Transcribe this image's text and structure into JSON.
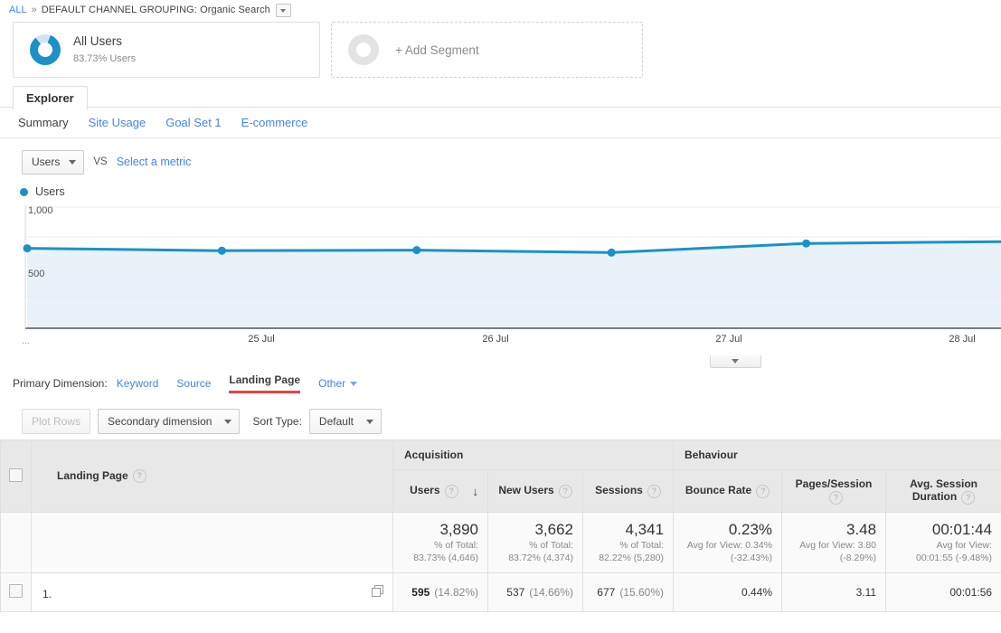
{
  "breadcrumb": {
    "all": "ALL",
    "separator": "»",
    "label": "DEFAULT CHANNEL GROUPING: Organic Search"
  },
  "segments": {
    "all_users": {
      "title": "All Users",
      "subtitle": "83.73% Users",
      "percent": 83.73
    },
    "add_segment": {
      "label": "+ Add Segment"
    }
  },
  "explorer": {
    "tab_label": "Explorer",
    "subtabs": [
      {
        "label": "Summary",
        "active": true
      },
      {
        "label": "Site Usage",
        "active": false
      },
      {
        "label": "Goal Set 1",
        "active": false
      },
      {
        "label": "E-commerce",
        "active": false
      }
    ]
  },
  "metric_selector": {
    "selected": "Users",
    "vs": "VS",
    "select_metric": "Select a metric"
  },
  "legend": {
    "label": "Users",
    "color": "#1c91c7"
  },
  "chart_data": {
    "type": "line",
    "title": "Users",
    "xlabel": "",
    "ylabel": "Users",
    "categories": [
      "",
      "25 Jul",
      "26 Jul",
      "27 Jul",
      "28 Jul",
      ""
    ],
    "x_tick_labels": [
      "25 Jul",
      "26 Jul",
      "27 Jul",
      "28 Jul"
    ],
    "y_tick_labels": [
      "1,000",
      "500"
    ],
    "ylim": [
      0,
      1000
    ],
    "grid": true,
    "legend_position": "top-left",
    "series": [
      {
        "name": "Users",
        "color": "#1c91c7",
        "fill": "#e8f2f8",
        "values": [
          660,
          640,
          645,
          625,
          700,
          715
        ]
      }
    ],
    "x_ellipsis": "..."
  },
  "primary_dimension": {
    "label": "Primary Dimension:",
    "items": [
      {
        "label": "Keyword",
        "active": false,
        "caret": false
      },
      {
        "label": "Source",
        "active": false,
        "caret": false
      },
      {
        "label": "Landing Page",
        "active": true,
        "caret": false
      },
      {
        "label": "Other",
        "active": false,
        "caret": true
      }
    ]
  },
  "toolbar": {
    "plot_rows": "Plot Rows",
    "secondary_dimension": "Secondary dimension",
    "sort_type_label": "Sort Type:",
    "sort_type_value": "Default"
  },
  "table": {
    "groups": [
      {
        "label": "Acquisition",
        "span": 3
      },
      {
        "label": "Behaviour",
        "span": 3
      }
    ],
    "dimension_header": "Landing Page",
    "columns": [
      {
        "label": "Users",
        "sorted": true,
        "sort_arrow": "↓"
      },
      {
        "label": "New Users",
        "sorted": false
      },
      {
        "label": "Sessions",
        "sorted": false
      },
      {
        "label": "Bounce Rate",
        "sorted": false
      },
      {
        "label": "Pages/Session",
        "sorted": false
      },
      {
        "label": "Avg. Session Duration",
        "sorted": false
      }
    ],
    "summary": [
      {
        "value": "3,890",
        "line1": "% of Total:",
        "line2": "83.73% (4,646)"
      },
      {
        "value": "3,662",
        "line1": "% of Total:",
        "line2": "83.72% (4,374)"
      },
      {
        "value": "4,341",
        "line1": "% of Total:",
        "line2": "82.22% (5,280)"
      },
      {
        "value": "0.23%",
        "line1": "Avg for View: 0.34%",
        "line2": "(-32.43%)"
      },
      {
        "value": "3.48",
        "line1": "Avg for View: 3.80",
        "line2": "(-8.29%)"
      },
      {
        "value": "00:01:44",
        "line1": "Avg for View:",
        "line2": "00:01:55 (-9.48%)"
      }
    ],
    "rows": [
      {
        "index": "1.",
        "dimension": "",
        "dimension_redacted": true,
        "users": "595",
        "users_pct": "(14.82%)",
        "new_users": "537",
        "new_users_pct": "(14.66%)",
        "sessions": "677",
        "sessions_pct": "(15.60%)",
        "bounce_rate": "0.44%",
        "pages_session": "3.11",
        "avg_duration": "00:01:56"
      }
    ]
  }
}
